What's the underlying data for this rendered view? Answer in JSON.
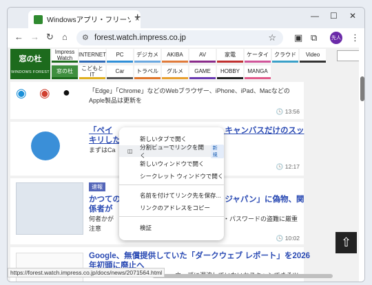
{
  "tab": {
    "title": "Windowsアプリ・フリーソフトのおすすめ情報 - 窓の杜",
    "close": "×",
    "new": "+"
  },
  "window": {
    "minimize": "—",
    "maximize": "☐",
    "close": "✕"
  },
  "toolbar": {
    "url": "forest.watch.impress.co.jp",
    "back": "←",
    "forward": "→",
    "reload": "↻",
    "home": "⌂",
    "profile": "先人"
  },
  "site": {
    "logo": "窓の杜",
    "logo_sub": "WINDOWS FOREST",
    "nav_row1": [
      "Impress Watch",
      "INTERNET",
      "PC",
      "デジカメ",
      "AKIBA",
      "AV",
      "家電",
      "ケータイ",
      "クラウド",
      "Video"
    ],
    "nav_row2": [
      "窓の杜",
      "こどもとIT",
      "Car",
      "トラベル",
      "グルメ",
      "GAME",
      "HOBBY",
      "MANGA"
    ]
  },
  "articles": [
    {
      "title": "",
      "body": "「Edge」「Chrome」などのWebブラウザー、iPhone、iPad、Macなどの Apple製品は更新を",
      "time": "13:56"
    },
    {
      "title": "「ペイ…キャンバスだけのスッキリした…",
      "title_left": "「ペイ",
      "title_right": "、キャンバスだけのスッ",
      "title_line2": "キリした",
      "body": "まずはCa",
      "time": "12:17"
    },
    {
      "tag": "速報",
      "title_left": "かつての",
      "title_right": "・ジャパン」に偽物、関",
      "title_line2": "係者が",
      "body_line1_left": "何者かが",
      "body_line1_right": "ID・パスワードの盗難に厳重",
      "body_line2": "注意",
      "time": "10:02"
    },
    {
      "title": "Google、無償提供していた「ダークウェブ レポート」を2026",
      "title_line2": "年初頭に廃止へ",
      "body": "…ウェブに漏洩していないかスキャンできるツール"
    }
  ],
  "context_menu": {
    "items": [
      {
        "label": "新しいタブで開く"
      },
      {
        "label": "分割ビューでリンクを開く",
        "badge": "新規"
      },
      {
        "label": "新しいウィンドウで開く"
      },
      {
        "label": "シークレット ウィンドウで開く"
      },
      {
        "label": "名前を付けてリンク先を保存..."
      },
      {
        "label": "リンクのアドレスをコピー"
      },
      {
        "label": "検証"
      }
    ]
  },
  "status_url": "https://forest.watch.impress.co.jp/docs/news/2071564.html",
  "colors": {
    "logo": "#1d6b1d",
    "link": "#2a4ab3",
    "avatar": "#6a2aa8"
  }
}
